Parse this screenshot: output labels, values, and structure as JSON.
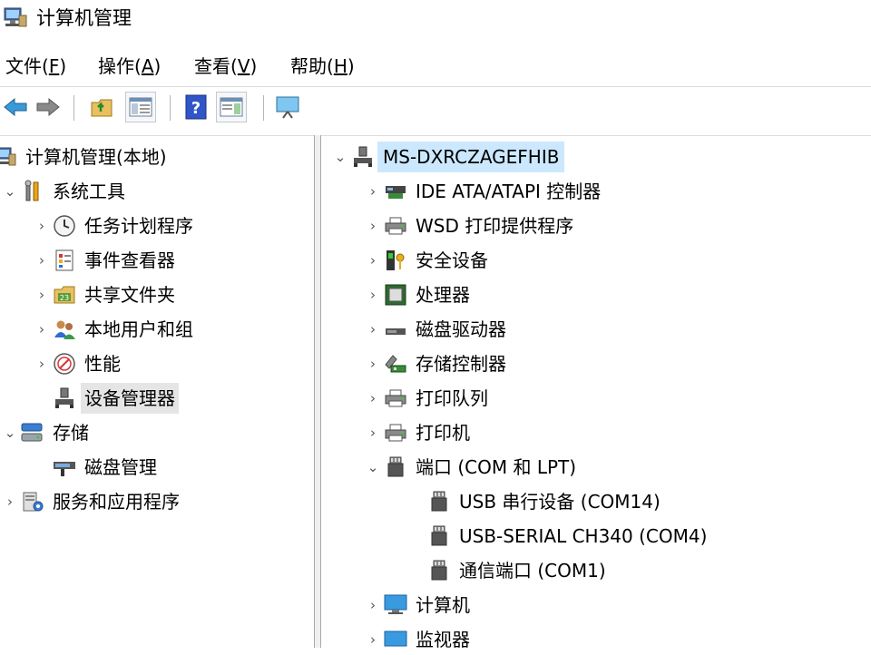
{
  "window": {
    "title": "计算机管理",
    "icon": "computer-management-icon"
  },
  "menu": [
    {
      "label": "文件(",
      "key": "F",
      "tail": ")"
    },
    {
      "label": "操作(",
      "key": "A",
      "tail": ")"
    },
    {
      "label": "查看(",
      "key": "V",
      "tail": ")"
    },
    {
      "label": "帮助(",
      "key": "H",
      "tail": ")"
    }
  ],
  "toolbar": {
    "buttons": [
      "back-arrow-icon",
      "forward-arrow-icon",
      "up-folder-icon",
      "show-hide-tree-icon",
      "help-icon",
      "action-pane-icon",
      "monitor-icon"
    ]
  },
  "left_tree": {
    "root": "计算机管理(本地)",
    "system_tools": "系统工具",
    "task_scheduler": "任务计划程序",
    "event_viewer": "事件查看器",
    "shared_folders": "共享文件夹",
    "local_users": "本地用户和组",
    "performance": "性能",
    "device_manager": "设备管理器",
    "storage": "存储",
    "disk_management": "磁盘管理",
    "services_apps": "服务和应用程序"
  },
  "right_tree": {
    "computer_name": "MS-DXRCZAGEFHIB",
    "categories": {
      "ide": "IDE ATA/ATAPI 控制器",
      "wsd": "WSD 打印提供程序",
      "security": "安全设备",
      "processor": "处理器",
      "disk": "磁盘驱动器",
      "storage_ctrl": "存储控制器",
      "print_queue": "打印队列",
      "printer": "打印机",
      "ports": "端口 (COM 和 LPT)",
      "port1": "USB 串行设备 (COM14)",
      "port2": "USB-SERIAL CH340 (COM4)",
      "port3": "通信端口 (COM1)",
      "computer": "计算机",
      "monitor": "监视器"
    }
  },
  "colors": {
    "selection": "#cce8ff",
    "selected_inactive": "#e5e5e5",
    "accent": "#1f7fd4"
  }
}
